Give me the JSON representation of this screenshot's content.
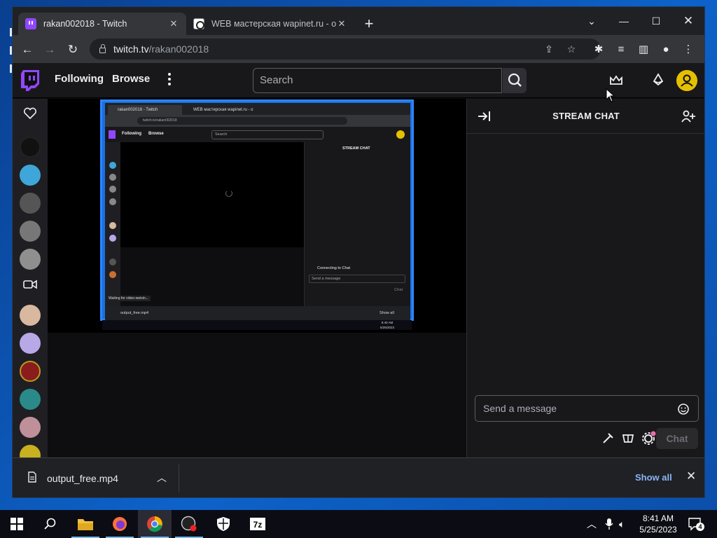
{
  "browser": {
    "tabs": [
      {
        "title": "rakan002018 - Twitch",
        "active": true
      },
      {
        "title": "WEB мастерская wapinet.ru - onl",
        "active": false
      }
    ],
    "url_host": "twitch.tv",
    "url_path": "/rakan002018"
  },
  "twitch": {
    "nav": {
      "following": "Following",
      "browse": "Browse",
      "search_placeholder": "Search"
    },
    "colors": {
      "brand": "#9147ff",
      "user_avatar": "#e5c000"
    },
    "chat": {
      "title": "STREAM CHAT",
      "input_placeholder": "Send a message",
      "chat_button": "Chat"
    }
  },
  "nested_screenshot": {
    "tab1": "rakan002018 - Twitch",
    "tab2": "WEB мастерская wapinet.ru - o",
    "url": "twitch.tv/rakan002018",
    "following": "Following",
    "browse": "Browse",
    "search": "Search",
    "chat_title": "STREAM CHAT",
    "connecting": "Connecting to Chat",
    "send": "Send a message",
    "chat_btn": "Chat",
    "waiting": "Waiting for video-weixin...",
    "download": "output_free.mp4",
    "show_all": "Show all",
    "time": "8:40 AM",
    "date": "5/25/2023"
  },
  "downloads": {
    "file": "output_free.mp4",
    "show_all": "Show all"
  },
  "taskbar": {
    "time": "8:41 AM",
    "date": "5/25/2023",
    "notifications": "4"
  }
}
